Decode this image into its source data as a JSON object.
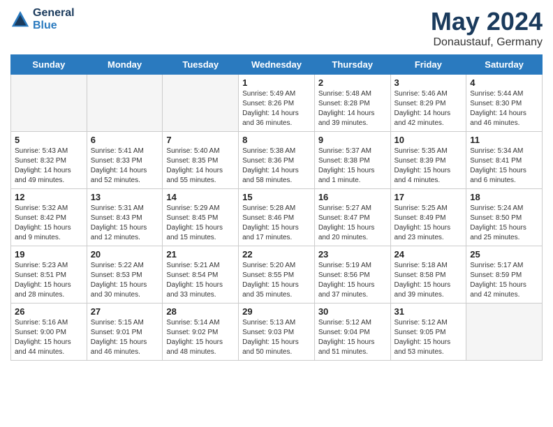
{
  "logo": {
    "line1": "General",
    "line2": "Blue"
  },
  "title": "May 2024",
  "location": "Donaustauf, Germany",
  "days_of_week": [
    "Sunday",
    "Monday",
    "Tuesday",
    "Wednesday",
    "Thursday",
    "Friday",
    "Saturday"
  ],
  "weeks": [
    [
      {
        "num": "",
        "info": ""
      },
      {
        "num": "",
        "info": ""
      },
      {
        "num": "",
        "info": ""
      },
      {
        "num": "1",
        "info": "Sunrise: 5:49 AM\nSunset: 8:26 PM\nDaylight: 14 hours\nand 36 minutes."
      },
      {
        "num": "2",
        "info": "Sunrise: 5:48 AM\nSunset: 8:28 PM\nDaylight: 14 hours\nand 39 minutes."
      },
      {
        "num": "3",
        "info": "Sunrise: 5:46 AM\nSunset: 8:29 PM\nDaylight: 14 hours\nand 42 minutes."
      },
      {
        "num": "4",
        "info": "Sunrise: 5:44 AM\nSunset: 8:30 PM\nDaylight: 14 hours\nand 46 minutes."
      }
    ],
    [
      {
        "num": "5",
        "info": "Sunrise: 5:43 AM\nSunset: 8:32 PM\nDaylight: 14 hours\nand 49 minutes."
      },
      {
        "num": "6",
        "info": "Sunrise: 5:41 AM\nSunset: 8:33 PM\nDaylight: 14 hours\nand 52 minutes."
      },
      {
        "num": "7",
        "info": "Sunrise: 5:40 AM\nSunset: 8:35 PM\nDaylight: 14 hours\nand 55 minutes."
      },
      {
        "num": "8",
        "info": "Sunrise: 5:38 AM\nSunset: 8:36 PM\nDaylight: 14 hours\nand 58 minutes."
      },
      {
        "num": "9",
        "info": "Sunrise: 5:37 AM\nSunset: 8:38 PM\nDaylight: 15 hours\nand 1 minute."
      },
      {
        "num": "10",
        "info": "Sunrise: 5:35 AM\nSunset: 8:39 PM\nDaylight: 15 hours\nand 4 minutes."
      },
      {
        "num": "11",
        "info": "Sunrise: 5:34 AM\nSunset: 8:41 PM\nDaylight: 15 hours\nand 6 minutes."
      }
    ],
    [
      {
        "num": "12",
        "info": "Sunrise: 5:32 AM\nSunset: 8:42 PM\nDaylight: 15 hours\nand 9 minutes."
      },
      {
        "num": "13",
        "info": "Sunrise: 5:31 AM\nSunset: 8:43 PM\nDaylight: 15 hours\nand 12 minutes."
      },
      {
        "num": "14",
        "info": "Sunrise: 5:29 AM\nSunset: 8:45 PM\nDaylight: 15 hours\nand 15 minutes."
      },
      {
        "num": "15",
        "info": "Sunrise: 5:28 AM\nSunset: 8:46 PM\nDaylight: 15 hours\nand 17 minutes."
      },
      {
        "num": "16",
        "info": "Sunrise: 5:27 AM\nSunset: 8:47 PM\nDaylight: 15 hours\nand 20 minutes."
      },
      {
        "num": "17",
        "info": "Sunrise: 5:25 AM\nSunset: 8:49 PM\nDaylight: 15 hours\nand 23 minutes."
      },
      {
        "num": "18",
        "info": "Sunrise: 5:24 AM\nSunset: 8:50 PM\nDaylight: 15 hours\nand 25 minutes."
      }
    ],
    [
      {
        "num": "19",
        "info": "Sunrise: 5:23 AM\nSunset: 8:51 PM\nDaylight: 15 hours\nand 28 minutes."
      },
      {
        "num": "20",
        "info": "Sunrise: 5:22 AM\nSunset: 8:53 PM\nDaylight: 15 hours\nand 30 minutes."
      },
      {
        "num": "21",
        "info": "Sunrise: 5:21 AM\nSunset: 8:54 PM\nDaylight: 15 hours\nand 33 minutes."
      },
      {
        "num": "22",
        "info": "Sunrise: 5:20 AM\nSunset: 8:55 PM\nDaylight: 15 hours\nand 35 minutes."
      },
      {
        "num": "23",
        "info": "Sunrise: 5:19 AM\nSunset: 8:56 PM\nDaylight: 15 hours\nand 37 minutes."
      },
      {
        "num": "24",
        "info": "Sunrise: 5:18 AM\nSunset: 8:58 PM\nDaylight: 15 hours\nand 39 minutes."
      },
      {
        "num": "25",
        "info": "Sunrise: 5:17 AM\nSunset: 8:59 PM\nDaylight: 15 hours\nand 42 minutes."
      }
    ],
    [
      {
        "num": "26",
        "info": "Sunrise: 5:16 AM\nSunset: 9:00 PM\nDaylight: 15 hours\nand 44 minutes."
      },
      {
        "num": "27",
        "info": "Sunrise: 5:15 AM\nSunset: 9:01 PM\nDaylight: 15 hours\nand 46 minutes."
      },
      {
        "num": "28",
        "info": "Sunrise: 5:14 AM\nSunset: 9:02 PM\nDaylight: 15 hours\nand 48 minutes."
      },
      {
        "num": "29",
        "info": "Sunrise: 5:13 AM\nSunset: 9:03 PM\nDaylight: 15 hours\nand 50 minutes."
      },
      {
        "num": "30",
        "info": "Sunrise: 5:12 AM\nSunset: 9:04 PM\nDaylight: 15 hours\nand 51 minutes."
      },
      {
        "num": "31",
        "info": "Sunrise: 5:12 AM\nSunset: 9:05 PM\nDaylight: 15 hours\nand 53 minutes."
      },
      {
        "num": "",
        "info": ""
      }
    ]
  ]
}
